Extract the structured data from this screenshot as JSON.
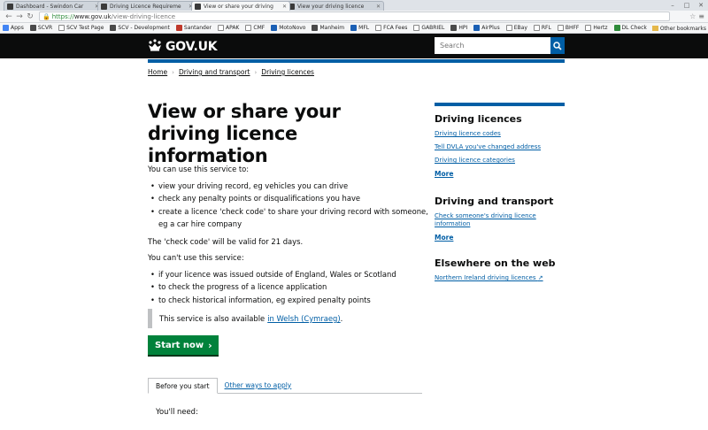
{
  "browser": {
    "tabs": [
      {
        "title": "Dashboard - Swindon Car",
        "active": false
      },
      {
        "title": "Driving Licence Requireme",
        "active": false
      },
      {
        "title": "View or share your driving",
        "active": true
      },
      {
        "title": "View your driving licence",
        "active": false
      }
    ],
    "url_secure": "https://",
    "url_host": "www.gov.uk",
    "url_path": "/view-driving-licence",
    "bookmarks": [
      "Apps",
      "SCVR",
      "SCV Test Page",
      "SCV - Development",
      "Santander",
      "APAK",
      "CMF",
      "MotoNovo",
      "Manheim",
      "MFL",
      "FCA Fees",
      "GABRIEL",
      "HPI",
      "AirPlus",
      "EBay",
      "RFL",
      "BHFF",
      "Hertz",
      "DL Check"
    ],
    "other_bookmarks": "Other bookmarks"
  },
  "header": {
    "logo": "GOV.UK",
    "search_placeholder": "Search"
  },
  "breadcrumb": [
    "Home",
    "Driving and transport",
    "Driving licences"
  ],
  "page": {
    "title": "View or share your driving licence information",
    "intro": "You can use this service to:",
    "can_list": [
      "view your driving record, eg vehicles you can drive",
      "check any penalty points or disqualifications you have",
      "create a licence 'check code' to share your driving record with someone, eg a car hire company"
    ],
    "valid_note": "The 'check code' will be valid for 21 days.",
    "cant_intro": "You can't use this service:",
    "cant_list": [
      "if your licence was issued outside of England, Wales or Scotland",
      "to check the progress of a licence application",
      "to check historical information, eg expired penalty points"
    ],
    "welsh_text": "This service is also available",
    "welsh_link": "in Welsh (Cymraeg)",
    "welsh_end": ".",
    "start_button": "Start now",
    "tabs": [
      "Before you start",
      "Other ways to apply"
    ],
    "you_need": "You'll need:"
  },
  "sidebar": {
    "section1": {
      "heading": "Driving licences",
      "links": [
        "Driving licence codes",
        "Tell DVLA you've changed address",
        "Driving licence categories"
      ],
      "more": "More"
    },
    "section2": {
      "heading": "Driving and transport",
      "links": [
        "Check someone's driving licence information"
      ],
      "more": "More"
    },
    "section3": {
      "heading": "Elsewhere on the web",
      "links": [
        "Northern Ireland driving licences"
      ]
    }
  }
}
